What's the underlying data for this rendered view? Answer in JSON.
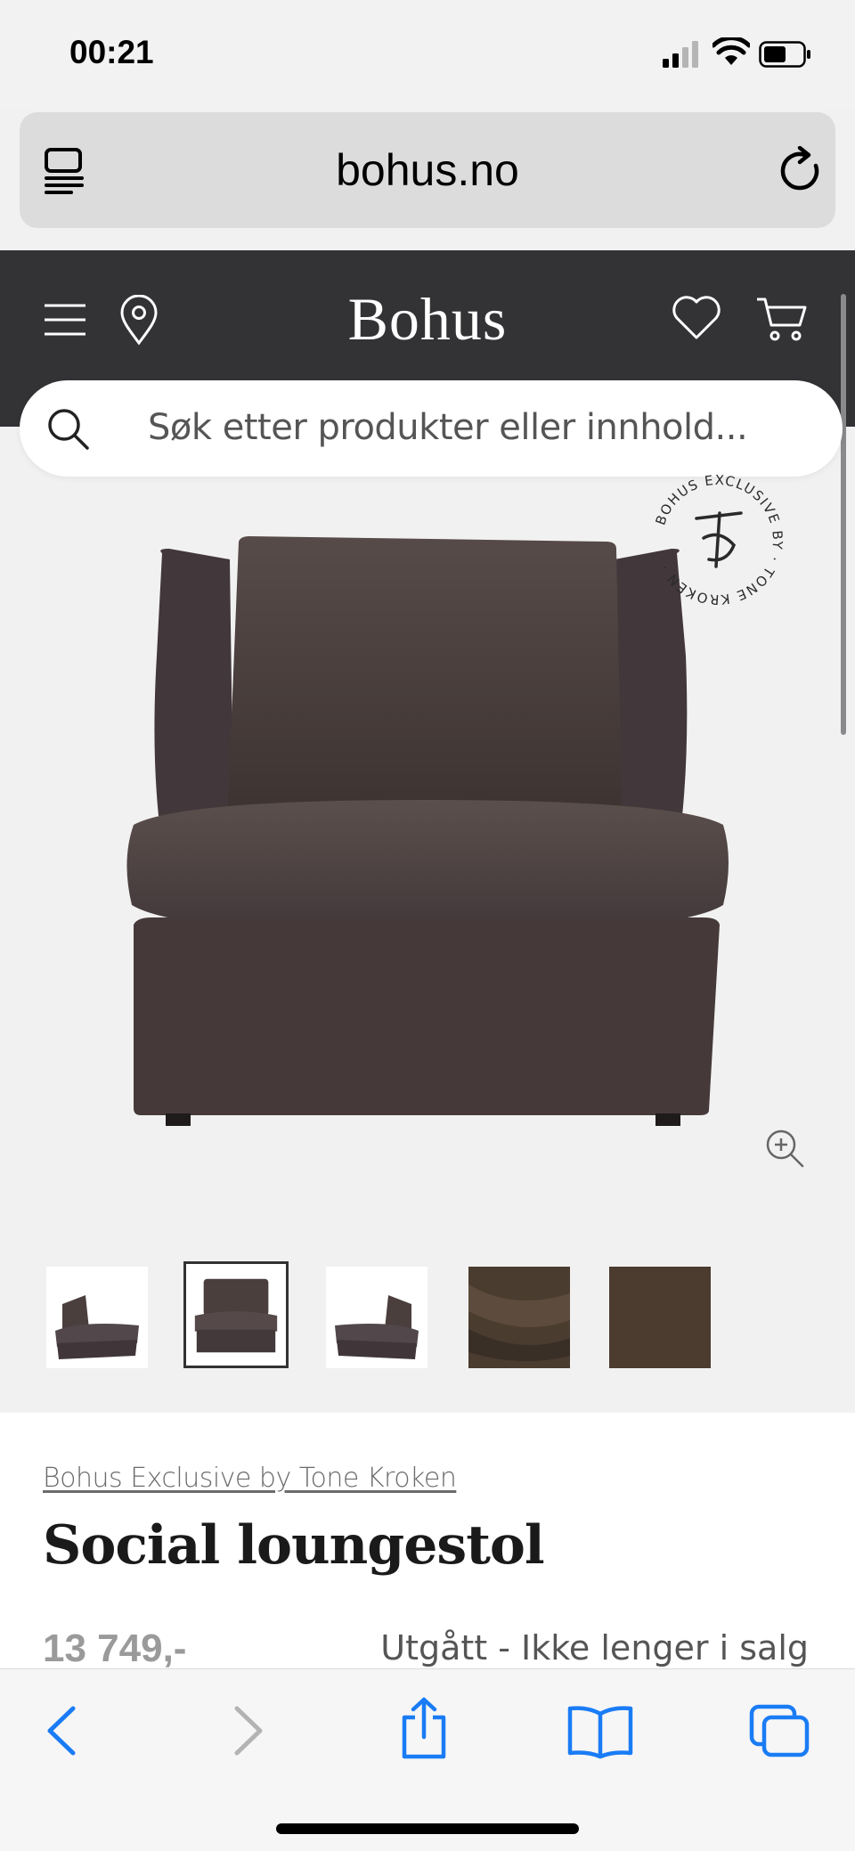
{
  "status": {
    "time": "00:21"
  },
  "browser": {
    "url": "bohus.no"
  },
  "site": {
    "logo": "Bohus",
    "search_placeholder": "Søk etter produkter eller innhold..."
  },
  "product": {
    "badge_text": "BOHUS EXCLUSIVE BY TONE KROKEN",
    "brand": "Bohus Exclusive by Tone Kroken",
    "title": "Social loungestol",
    "price": "13 749,-",
    "status": "Utgått - Ikke lenger i salg",
    "thumbnails": [
      "chair-angle-left",
      "chair-front",
      "chair-angle-right",
      "fabric-swatch-folded",
      "fabric-swatch-flat"
    ],
    "active_thumbnail": 2
  },
  "colors": {
    "header": "#333336",
    "fabric": "#4a3f3d",
    "ios_blue": "#1a7cf5"
  }
}
